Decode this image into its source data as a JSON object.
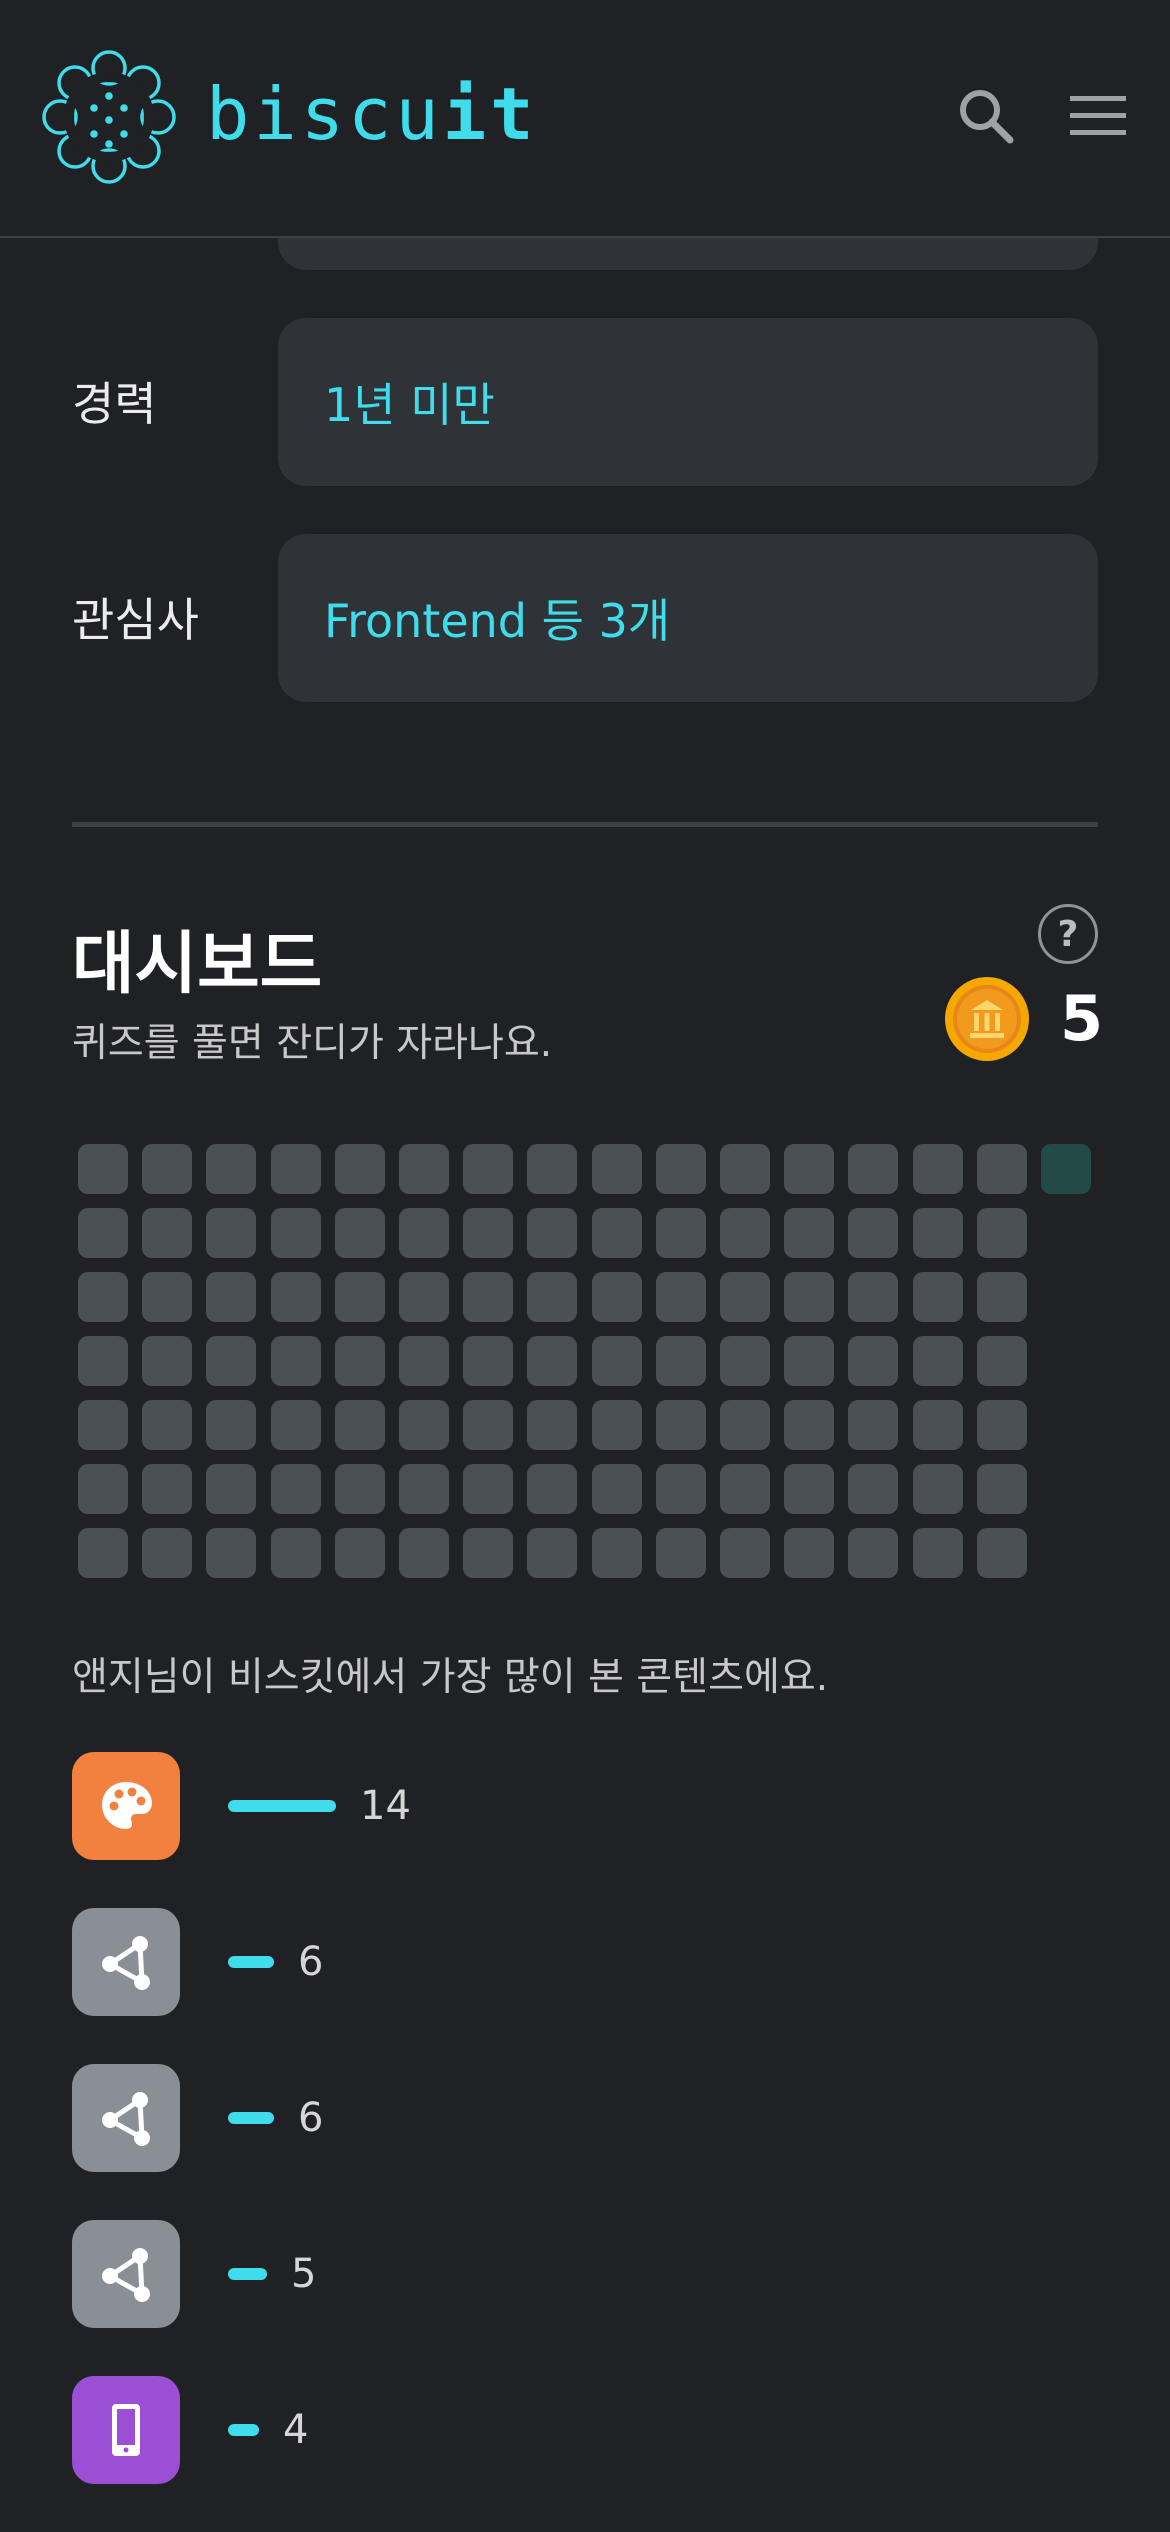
{
  "header": {
    "logo_prefix": "biscu",
    "logo_suffix": "it",
    "search_icon": "search-icon",
    "menu_icon": "hamburger-menu-icon"
  },
  "profile": {
    "career_label": "경력",
    "career_value": "1년 미만",
    "interest_label": "관심사",
    "interest_value": "Frontend 등 3개"
  },
  "dashboard": {
    "title": "대시보드",
    "subtitle": "퀴즈를 풀면 잔디가 자라나요.",
    "help_label": "?",
    "coin_count": "5",
    "grass_active_count": 1,
    "content_subtitle": "앤지님이 비스킷에서 가장 많이 본 콘텐츠에요.",
    "top_contents": [
      {
        "icon": "palette-icon",
        "icon_bg": "#f2803f",
        "count": "14"
      },
      {
        "icon": "share-nodes-icon",
        "icon_bg": "#8a8f96",
        "count": "6"
      },
      {
        "icon": "share-nodes-icon",
        "icon_bg": "#8a8f96",
        "count": "6"
      },
      {
        "icon": "share-nodes-icon",
        "icon_bg": "#8a8f96",
        "count": "5"
      },
      {
        "icon": "mobile-phone-icon",
        "icon_bg": "#9b4fd4",
        "count": "4"
      }
    ]
  },
  "colors": {
    "background": "#202124",
    "accent": "#3fdceb",
    "field_bg": "#2f3337",
    "grass_empty": "#4b5055",
    "grass_active": "#244a48",
    "coin": "#f5a800"
  }
}
